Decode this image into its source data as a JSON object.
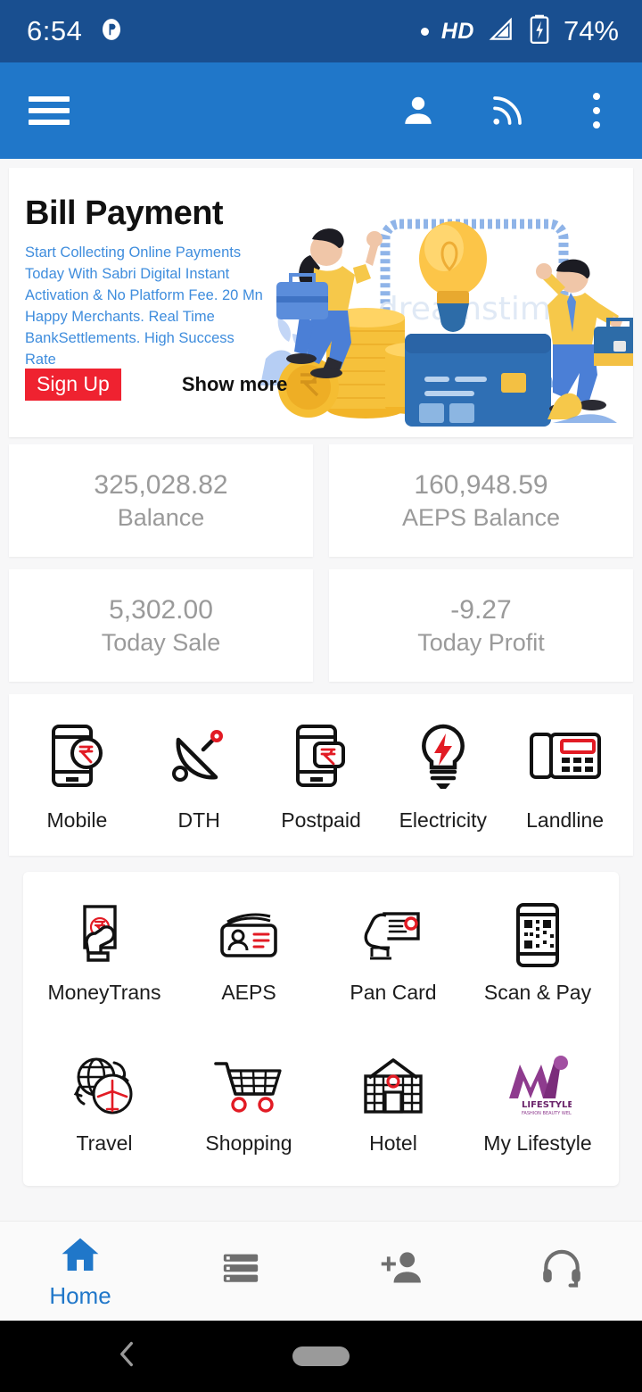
{
  "statusbar": {
    "time": "6:54",
    "network_mode": "HD",
    "battery_percent": "74%",
    "icons": [
      "app-notification-icon",
      "dot-icon",
      "hd-icon",
      "signal-icon",
      "battery-charging-icon"
    ]
  },
  "appbar": {
    "menu_icon": "hamburger-menu-icon",
    "actions": [
      {
        "name": "profile-icon",
        "label": "Profile"
      },
      {
        "name": "rss-feed-icon",
        "label": "Feed"
      },
      {
        "name": "overflow-menu-icon",
        "label": "More options"
      }
    ]
  },
  "banner": {
    "title": "Bill Payment",
    "subtitle": "Start Collecting Online Payments Today With Sabri Digital Instant Activation & No Platform Fee. 20 Mn Happy Merchants. Real Time BankSettlements. High Success Rate",
    "signup_label": "Sign Up",
    "show_more_label": "Show more",
    "signup_color": "#ef2230",
    "subtitle_color": "#3f8ddd"
  },
  "stats": [
    {
      "value": "325,028.82",
      "label": "Balance"
    },
    {
      "value": "160,948.59",
      "label": "AEPS Balance"
    },
    {
      "value": "5,302.00",
      "label": "Today Sale"
    },
    {
      "value": "-9.27",
      "label": "Today Profit"
    }
  ],
  "quick_services": [
    {
      "label": "Mobile",
      "icon": "mobile-recharge-icon"
    },
    {
      "label": "DTH",
      "icon": "satellite-dish-icon"
    },
    {
      "label": "Postpaid",
      "icon": "postpaid-phone-icon"
    },
    {
      "label": "Electricity",
      "icon": "light-bulb-icon"
    },
    {
      "label": "Landline",
      "icon": "landline-phone-icon"
    }
  ],
  "services": [
    [
      {
        "label": "MoneyTrans",
        "icon": "hand-cash-icon"
      },
      {
        "label": "AEPS",
        "icon": "id-card-icon"
      },
      {
        "label": "Pan Card",
        "icon": "pan-card-icon"
      },
      {
        "label": "Scan & Pay",
        "icon": "qr-scan-icon"
      }
    ],
    [
      {
        "label": "Travel",
        "icon": "globe-airplane-icon"
      },
      {
        "label": "Shopping",
        "icon": "shopping-cart-icon"
      },
      {
        "label": "Hotel",
        "icon": "hotel-building-icon"
      },
      {
        "label": "My Lifestyle",
        "icon": "my-lifestyle-logo-icon"
      }
    ]
  ],
  "bottom_nav": [
    {
      "label": "Home",
      "icon": "home-icon",
      "active": true
    },
    {
      "label": "",
      "icon": "list-reports-icon",
      "active": false
    },
    {
      "label": "",
      "icon": "add-person-icon",
      "active": false
    },
    {
      "label": "",
      "icon": "headset-support-icon",
      "active": false
    }
  ],
  "android_nav": {
    "back_icon": "back-chevron-icon",
    "home_icon": "home-pill-icon"
  },
  "colors": {
    "statusbar": "#194f90",
    "appbar": "#2077c9",
    "accent_red": "#ef2230",
    "accent_blue": "#2077c9",
    "page_bg": "#f7f7f8"
  }
}
